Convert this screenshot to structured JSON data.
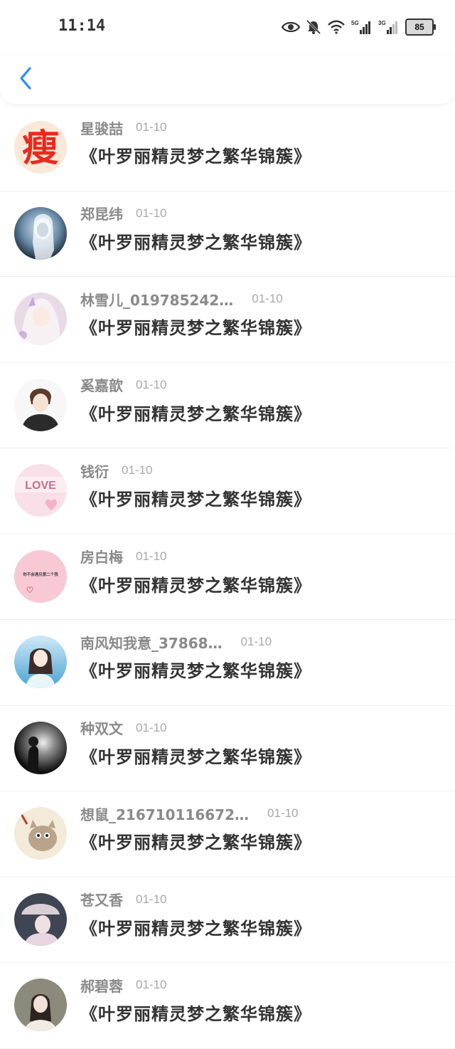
{
  "status_bar": {
    "time": "11:14",
    "network_1": "5G",
    "network_2": "3G",
    "battery": "85",
    "icons": [
      "eye-icon",
      "bell-muted-icon",
      "wifi-icon",
      "signal-5g-icon",
      "signal-3g-icon",
      "battery-icon"
    ]
  },
  "header": {
    "back_icon": "chevron-left-icon",
    "accent": "#2b8ef0"
  },
  "items": [
    {
      "name": "星骏喆",
      "date": "01-10",
      "message": "《叶罗丽精灵梦之繁华锦簇》"
    },
    {
      "name": "郑昆纬",
      "date": "01-10",
      "message": "《叶罗丽精灵梦之繁华锦簇》"
    },
    {
      "name": "林雪儿_019785242…",
      "date": "01-10",
      "message": "《叶罗丽精灵梦之繁华锦簇》"
    },
    {
      "name": "奚嘉歆",
      "date": "01-10",
      "message": "《叶罗丽精灵梦之繁华锦簇》"
    },
    {
      "name": "钱衍",
      "date": "01-10",
      "message": "《叶罗丽精灵梦之繁华锦簇》"
    },
    {
      "name": "房白梅",
      "date": "01-10",
      "message": "《叶罗丽精灵梦之繁华锦簇》"
    },
    {
      "name": "南风知我意_37868…",
      "date": "01-10",
      "message": "《叶罗丽精灵梦之繁华锦簇》"
    },
    {
      "name": "种双文",
      "date": "01-10",
      "message": "《叶罗丽精灵梦之繁华锦簇》"
    },
    {
      "name": "想鼠_216710116672…",
      "date": "01-10",
      "message": "《叶罗丽精灵梦之繁华锦簇》"
    },
    {
      "name": "苍又香",
      "date": "01-10",
      "message": "《叶罗丽精灵梦之繁华锦簇》"
    },
    {
      "name": "郝碧蓉",
      "date": "01-10",
      "message": "《叶罗丽精灵梦之繁华锦簇》"
    }
  ],
  "avatar_texts": {
    "avatar_1": "瘦",
    "avatar_5": "LOVE",
    "avatar_6": "你不会遇见第二个我"
  }
}
